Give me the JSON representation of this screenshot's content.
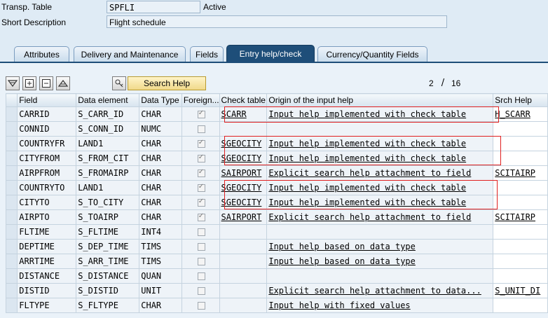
{
  "header": {
    "transp_label": "Transp. Table",
    "transp_value": "SPFLI",
    "status": "Active",
    "desc_label": "Short Description",
    "desc_value": "Flight schedule"
  },
  "tabs": [
    {
      "label": "Attributes"
    },
    {
      "label": "Delivery and Maintenance"
    },
    {
      "label": "Fields"
    },
    {
      "label": "Entry help/check"
    },
    {
      "label": "Currency/Quantity Fields"
    }
  ],
  "active_tab": "Entry help/check",
  "toolbar": {
    "search_help_label": "Search Help",
    "page_current": "2",
    "page_sep": "/",
    "page_total": "16"
  },
  "columns": [
    "Field",
    "Data element",
    "Data Type",
    "Foreign...",
    "Check table",
    "Origin of the input help",
    "Srch Help"
  ],
  "rows": [
    {
      "field": "CARRID",
      "element": "S_CARR_ID",
      "type": "CHAR",
      "foreign": true,
      "check": "SCARR",
      "origin": "Input help implemented with check table",
      "srch": "H_SCARR"
    },
    {
      "field": "CONNID",
      "element": "S_CONN_ID",
      "type": "NUMC",
      "foreign": false,
      "check": "",
      "origin": "",
      "srch": ""
    },
    {
      "field": "COUNTRYFR",
      "element": "LAND1",
      "type": "CHAR",
      "foreign": true,
      "check": "SGEOCITY",
      "origin": "Input help implemented with check table",
      "srch": ""
    },
    {
      "field": "CITYFROM",
      "element": "S_FROM_CIT",
      "type": "CHAR",
      "foreign": true,
      "check": "SGEOCITY",
      "origin": "Input help implemented with check table",
      "srch": ""
    },
    {
      "field": "AIRPFROM",
      "element": "S_FROMAIRP",
      "type": "CHAR",
      "foreign": true,
      "check": "SAIRPORT",
      "origin": "Explicit search help attachment to field",
      "srch": "SCITAIRP"
    },
    {
      "field": "COUNTRYTO",
      "element": "LAND1",
      "type": "CHAR",
      "foreign": true,
      "check": "SGEOCITY",
      "origin": "Input help implemented with check table",
      "srch": ""
    },
    {
      "field": "CITYTO",
      "element": "S_TO_CITY",
      "type": "CHAR",
      "foreign": true,
      "check": "SGEOCITY",
      "origin": "Input help implemented with check table",
      "srch": ""
    },
    {
      "field": "AIRPTO",
      "element": "S_TOAIRP",
      "type": "CHAR",
      "foreign": true,
      "check": "SAIRPORT",
      "origin": "Explicit search help attachment to field",
      "srch": "SCITAIRP"
    },
    {
      "field": "FLTIME",
      "element": "S_FLTIME",
      "type": "INT4",
      "foreign": false,
      "check": "",
      "origin": "",
      "srch": ""
    },
    {
      "field": "DEPTIME",
      "element": "S_DEP_TIME",
      "type": "TIMS",
      "foreign": false,
      "check": "",
      "origin": "Input help based on data type",
      "srch": ""
    },
    {
      "field": "ARRTIME",
      "element": "S_ARR_TIME",
      "type": "TIMS",
      "foreign": false,
      "check": "",
      "origin": "Input help based on data type",
      "srch": ""
    },
    {
      "field": "DISTANCE",
      "element": "S_DISTANCE",
      "type": "QUAN",
      "foreign": false,
      "check": "",
      "origin": "",
      "srch": ""
    },
    {
      "field": "DISTID",
      "element": "S_DISTID",
      "type": "UNIT",
      "foreign": false,
      "check": "",
      "origin": "Explicit search help attachment to data...",
      "srch": "S_UNIT_DI"
    },
    {
      "field": "FLTYPE",
      "element": "S_FLTYPE",
      "type": "CHAR",
      "foreign": false,
      "check": "",
      "origin": "Input help with fixed values",
      "srch": ""
    }
  ]
}
